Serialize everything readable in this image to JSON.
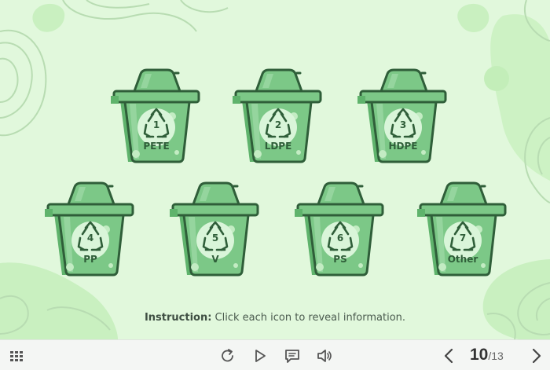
{
  "bins": [
    {
      "number": "1",
      "label": "PETE"
    },
    {
      "number": "2",
      "label": "LDPE"
    },
    {
      "number": "3",
      "label": "HDPE"
    },
    {
      "number": "4",
      "label": "PP"
    },
    {
      "number": "5",
      "label": "V"
    },
    {
      "number": "6",
      "label": "PS"
    },
    {
      "number": "7",
      "label": "Other"
    }
  ],
  "instruction": {
    "prefix": "Instruction:",
    "text": " Click each icon to reveal information."
  },
  "toolbar": {
    "menu_icon": "grid-menu-icon",
    "replay_icon": "replay-icon",
    "play_icon": "play-icon",
    "notes_icon": "notes-icon",
    "volume_icon": "volume-icon",
    "prev_icon": "chevron-left-icon",
    "next_icon": "chevron-right-icon",
    "page_current": "10",
    "page_total": "/13"
  },
  "colors": {
    "background": "#e1f8dc",
    "bin_fill": "#7cc887",
    "bin_shadow": "#5fb36c",
    "bin_outline": "#2f5e39",
    "symbol_circle": "#d9f5d9"
  }
}
